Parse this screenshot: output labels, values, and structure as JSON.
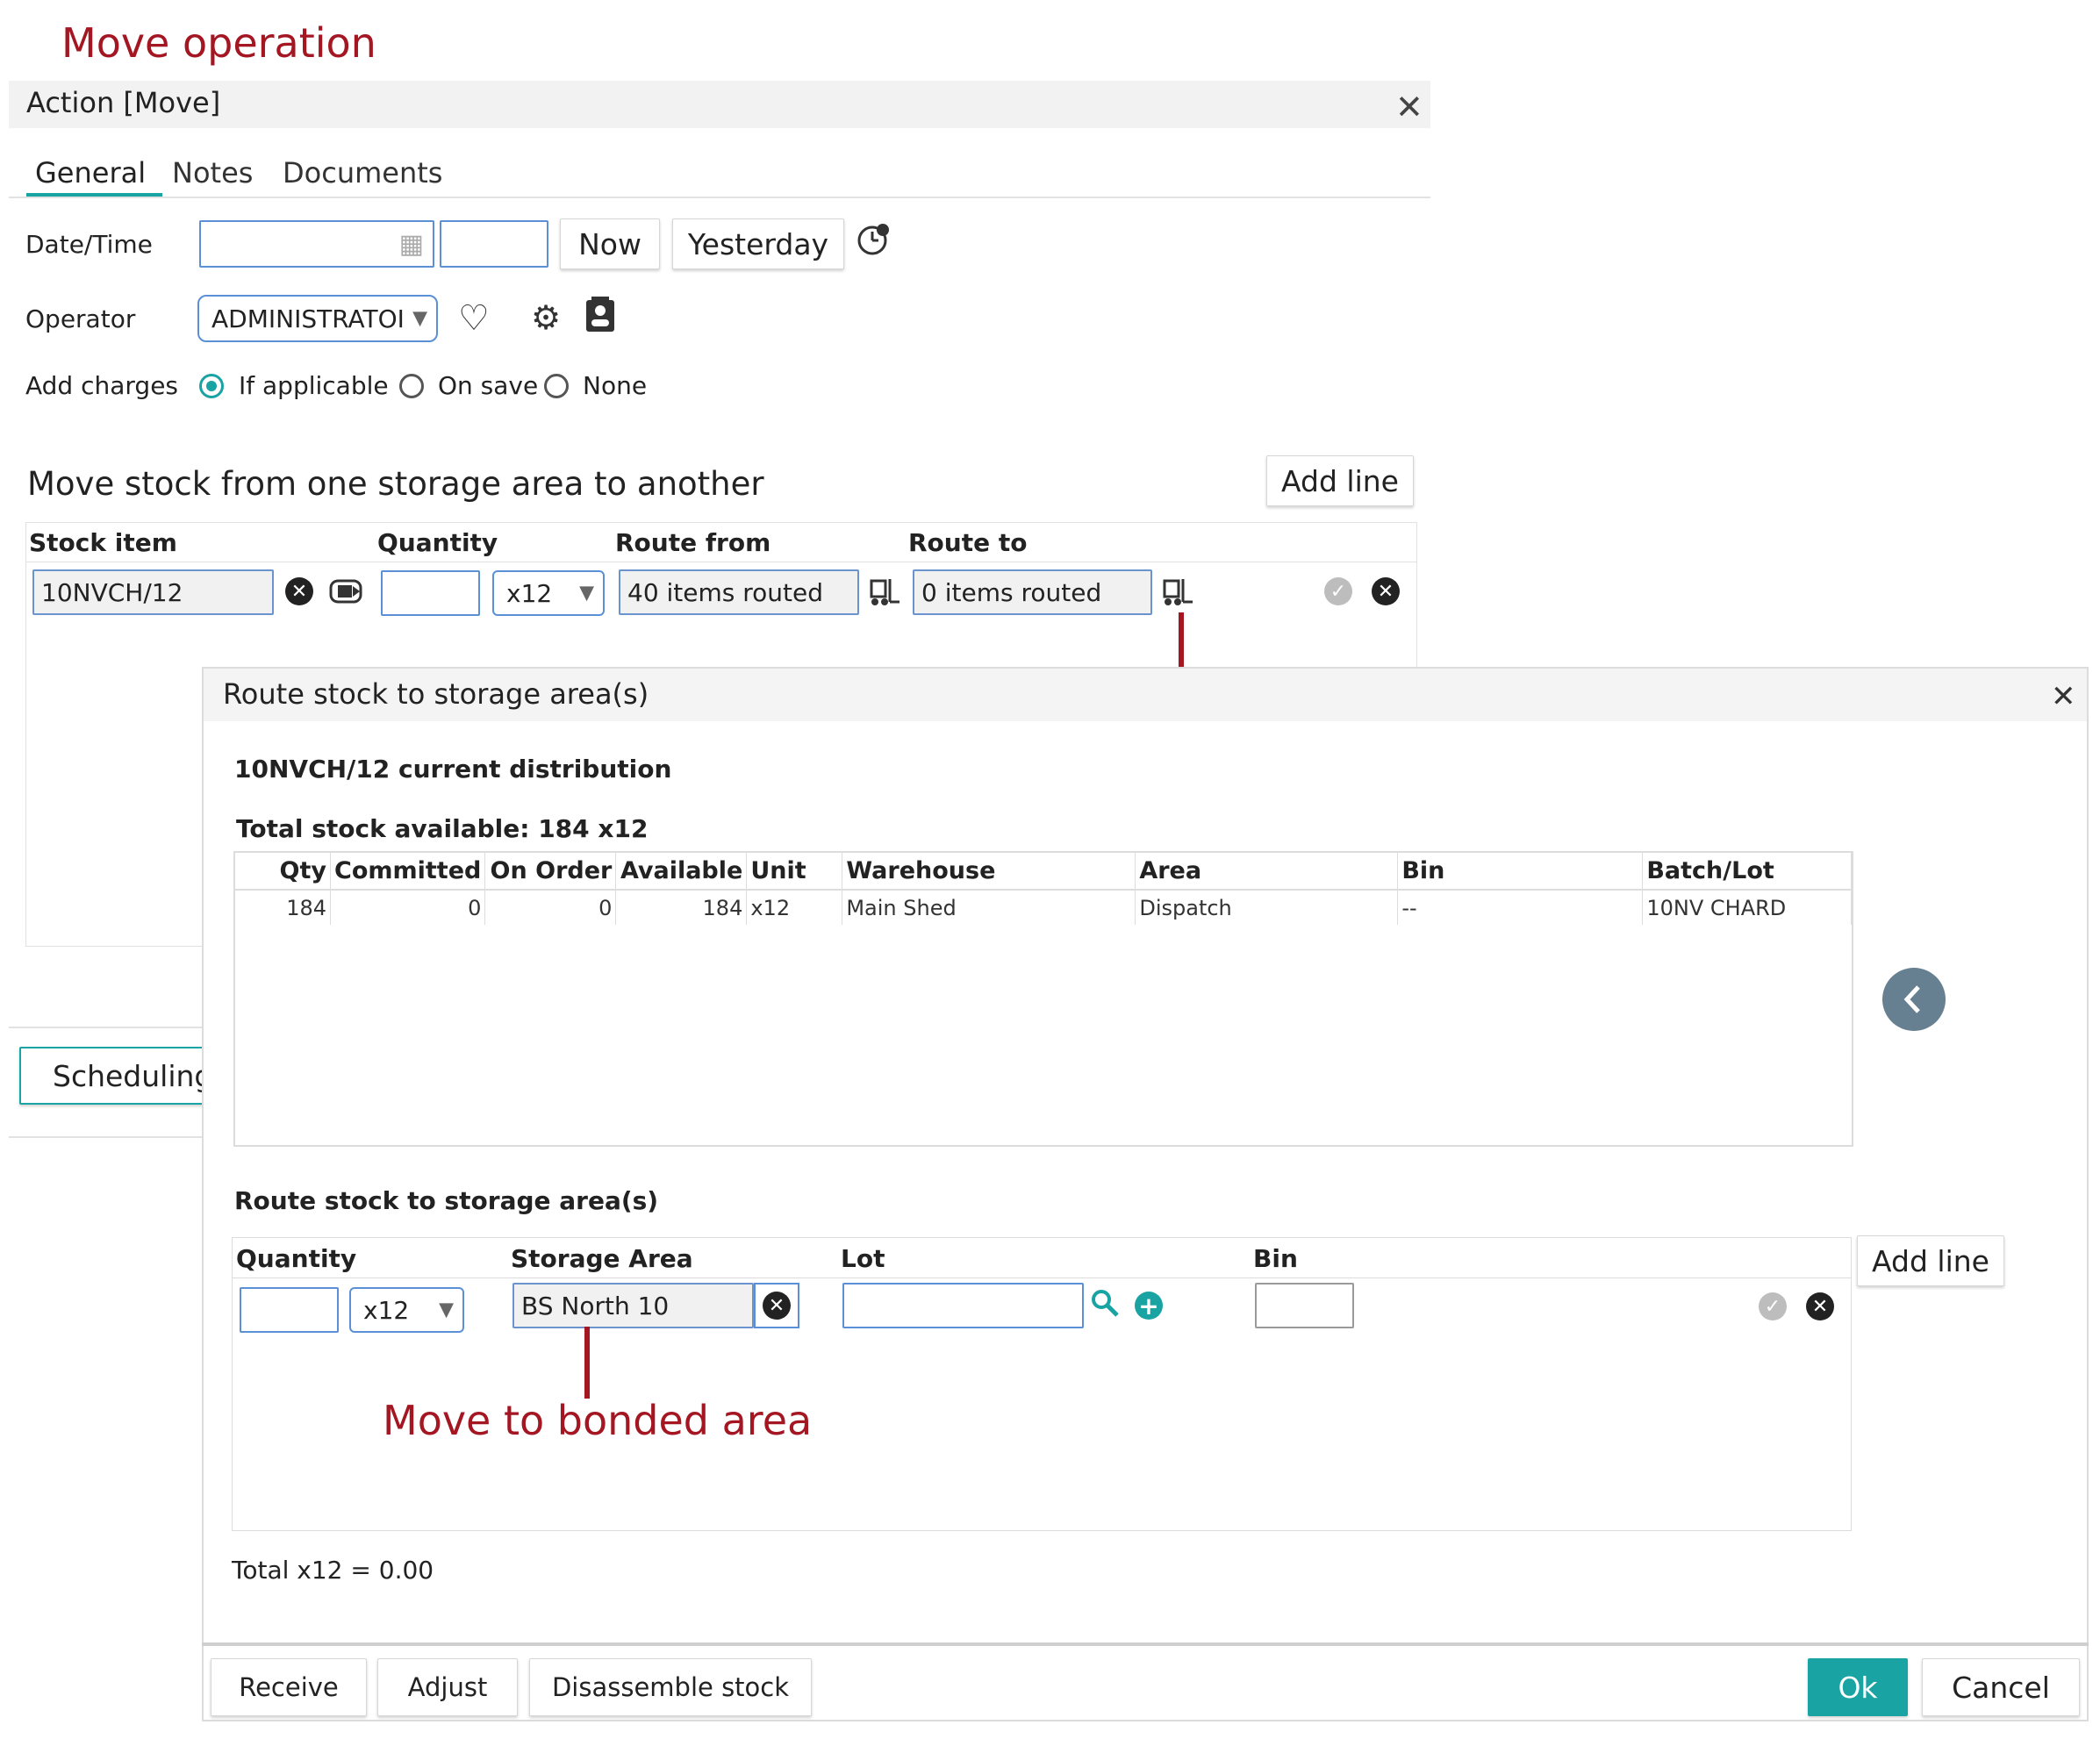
{
  "annotations": {
    "title": "Move operation",
    "bonded_note": "Move to bonded area"
  },
  "action_dialog": {
    "title": "Action [Move]",
    "tabs": [
      "General",
      "Notes",
      "Documents"
    ],
    "date_label": "Date/Time",
    "date_value": "",
    "time_value": "",
    "now_label": "Now",
    "yesterday_label": "Yesterday",
    "operator_label": "Operator",
    "operator_value": "ADMINISTRATOI",
    "charges_label": "Add charges",
    "charge_options": [
      "If applicable",
      "On save",
      "None"
    ],
    "charge_selected": "If applicable",
    "section_title": "Move stock from one storage area to another",
    "add_line_label": "Add line",
    "columns": [
      "Stock item",
      "Quantity",
      "Route from",
      "Route to"
    ],
    "line": {
      "stock_item": "10NVCH/12",
      "quantity": "",
      "unit": "x12",
      "route_from": "40 items routed",
      "route_to": "0 items routed"
    },
    "scheduling_label": "Scheduling"
  },
  "route_dialog": {
    "title": "Route stock to storage area(s)",
    "distribution_title": "10NVCH/12 current distribution",
    "total_available": "Total stock available: 184 x12",
    "columns": [
      "Qty",
      "Committed",
      "On Order",
      "Available",
      "Unit",
      "Warehouse",
      "Area",
      "Bin",
      "Batch/Lot"
    ],
    "rows": [
      [
        "184",
        "0",
        "0",
        "184",
        "x12",
        "Main Shed",
        "Dispatch",
        "--",
        "10NV CHARD"
      ]
    ],
    "route_section_title": "Route stock to storage area(s)",
    "route_columns": [
      "Quantity",
      "Storage Area",
      "Lot",
      "Bin"
    ],
    "route_line": {
      "quantity": "",
      "unit": "x12",
      "storage_area": "BS North 10",
      "lot": "",
      "bin": ""
    },
    "add_line_label": "Add line",
    "total": "Total x12 = 0.00"
  },
  "footer": {
    "receive": "Receive",
    "adjust": "Adjust",
    "disassemble": "Disassemble stock",
    "ok": "Ok",
    "cancel": "Cancel"
  },
  "colors": {
    "accent": "#1aa3a3",
    "annotation": "#a31622",
    "input_border": "#5b8fd6"
  }
}
